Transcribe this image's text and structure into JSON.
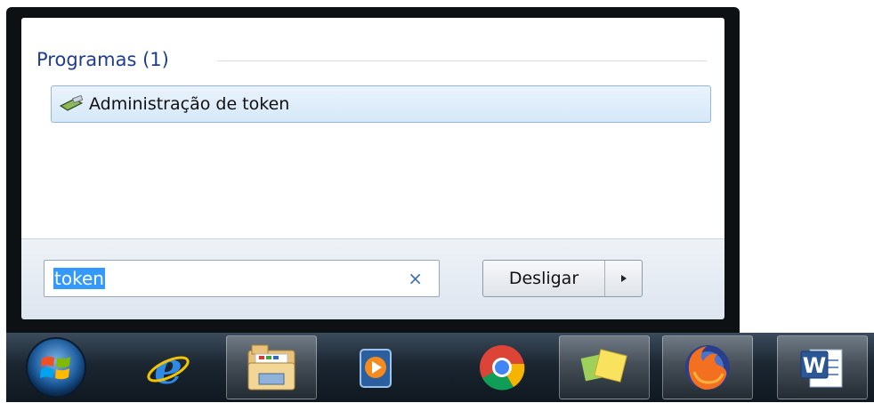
{
  "start_menu": {
    "section_title": "Programas (1)",
    "results": [
      {
        "label": "Administração de token",
        "icon": "token-admin-icon"
      }
    ],
    "search": {
      "value": "token",
      "clear_symbol": "×"
    },
    "shutdown": {
      "label": "Desligar"
    }
  },
  "taskbar": {
    "items": [
      {
        "name": "internet-explorer",
        "icon": "internet-explorer-icon"
      },
      {
        "name": "windows-explorer",
        "icon": "folder-icon"
      },
      {
        "name": "media-player",
        "icon": "media-player-icon"
      },
      {
        "name": "chrome",
        "icon": "chrome-icon"
      },
      {
        "name": "sticky-notes",
        "icon": "sticky-notes-icon"
      },
      {
        "name": "firefox",
        "icon": "firefox-icon"
      },
      {
        "name": "word",
        "icon": "word-icon",
        "letter": "W"
      }
    ]
  },
  "colors": {
    "accent_blue": "#1e3e8c",
    "selection_blue": "#3399ff",
    "taskbar_dark": "#0f1820"
  }
}
